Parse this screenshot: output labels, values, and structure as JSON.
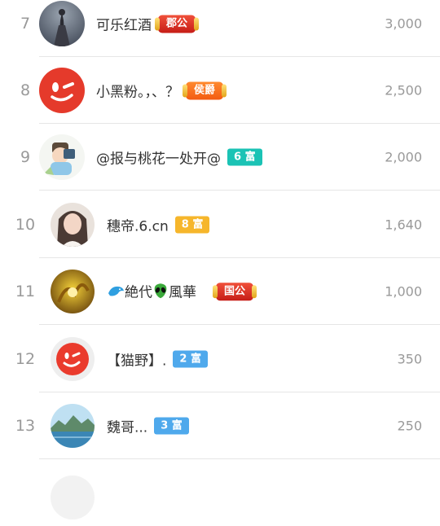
{
  "colors": {
    "rank_text": "#999999",
    "name_text": "#333333",
    "divider": "#e6e6e6",
    "title_red": "#d92a1f",
    "title_orange": "#f46a1e",
    "rich_teal": "#1bc3b5",
    "rich_yellow": "#f6b62b",
    "rich_blue": "#4fa9ec"
  },
  "rows": [
    {
      "rank": "7",
      "name": "可乐红酒",
      "badge": {
        "kind": "title",
        "text": "郡公",
        "color": "red"
      },
      "score": "3,000",
      "avatar_icon": "statue-avatar"
    },
    {
      "rank": "8",
      "name": "小黑粉。，、？",
      "badge": {
        "kind": "title",
        "text": "侯爵",
        "color": "orange"
      },
      "score": "2,500",
      "avatar_icon": "wink-face-avatar"
    },
    {
      "rank": "9",
      "name": "@报与桃花一处开@",
      "badge": {
        "kind": "rich",
        "text": "6 富",
        "color": "teal"
      },
      "score": "2,000",
      "avatar_icon": "cartoon-boy-avatar"
    },
    {
      "rank": "10",
      "name": "穗帝.6.cn",
      "badge": {
        "kind": "rich",
        "text": "8 富",
        "color": "yellow"
      },
      "score": "1,640",
      "avatar_icon": "girl-photo-avatar"
    },
    {
      "rank": "11",
      "name": "絶代",
      "name_part2": "風華",
      "badge": {
        "kind": "title",
        "text": "国公",
        "color": "red"
      },
      "score": "1,000",
      "avatar_icon": "golden-dragon-avatar"
    },
    {
      "rank": "12",
      "name": "【猫野】.",
      "badge": {
        "kind": "rich",
        "text": "2 富",
        "color": "blue"
      },
      "score": "350",
      "avatar_icon": "wink-face-avatar"
    },
    {
      "rank": "13",
      "name": "魏哥...",
      "badge": {
        "kind": "rich",
        "text": "3 富",
        "color": "blue"
      },
      "score": "250",
      "avatar_icon": "lake-landscape-avatar"
    }
  ]
}
